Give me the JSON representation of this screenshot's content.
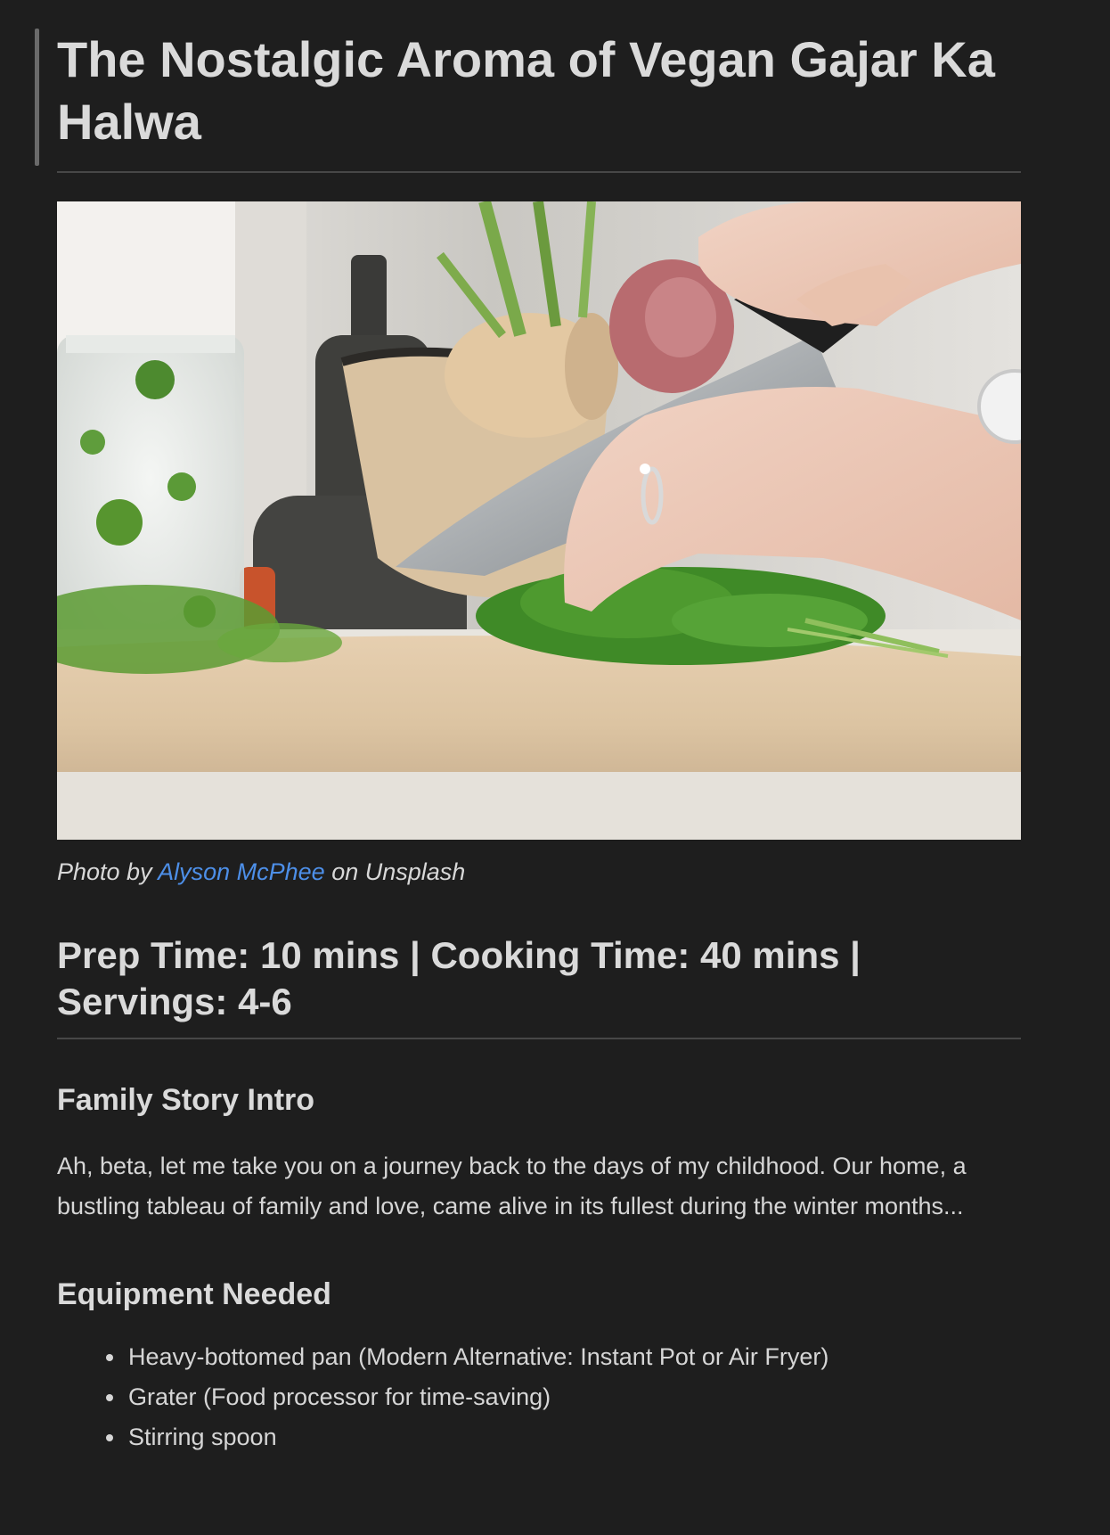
{
  "article": {
    "title": "The Nostalgic Aroma of Vegan Gajar Ka Halwa",
    "caption": {
      "prefix": "Photo by",
      "author": "Alyson McPhee",
      "suffix": "on Unsplash"
    },
    "meta_heading": "Prep Time: 10 mins | Cooking Time: 40 mins | Servings: 4-6",
    "story": {
      "heading": "Family Story Intro",
      "text": "Ah, beta, let me take you on a journey back to the days of my childhood. Our home, a bustling tableau of family and love, came alive in its fullest during the winter months..."
    },
    "equipment": {
      "heading": "Equipment Needed",
      "items": [
        "Heavy-bottomed pan (Modern Alternative: Instant Pot or Air Fryer)",
        "Grater (Food processor for time-saving)",
        "Stirring spoon"
      ]
    }
  },
  "colors": {
    "background": "#1e1e1e",
    "text": "#dadada",
    "link": "#4d8fe8",
    "rule": "#474747"
  }
}
